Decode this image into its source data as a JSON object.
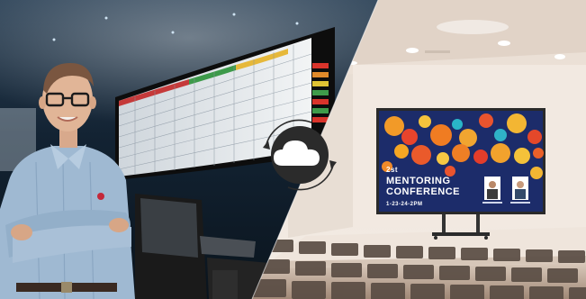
{
  "conference_screen": {
    "line1": "2st",
    "line2": "MENTORING",
    "line3": "CONFERENCE",
    "date": "1-23-24-2PM"
  },
  "icons": {
    "center": "cloud-sync-icon"
  },
  "colors": {
    "left_bg_dark": "#0f1f2e",
    "right_wall": "#efe6dd",
    "screen_bg": "#1a2f6e",
    "cloud_badge": "#2b2b2b"
  }
}
